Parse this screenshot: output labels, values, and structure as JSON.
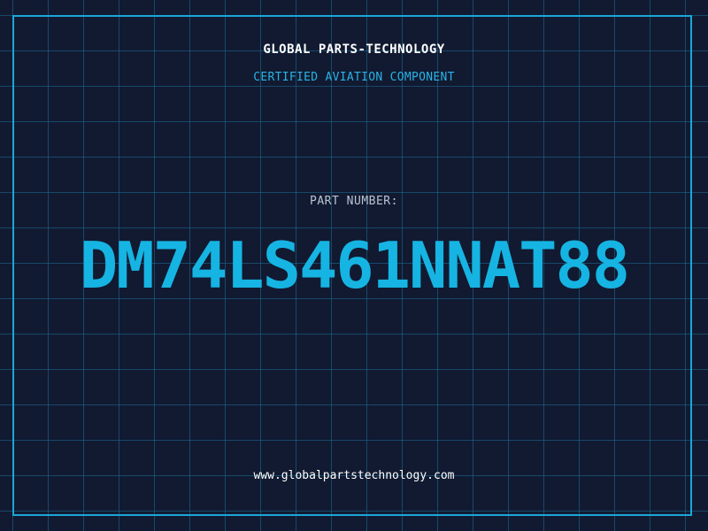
{
  "header": {
    "brand": "GLOBAL PARTS-TECHNOLOGY",
    "subtitle": "CERTIFIED AVIATION COMPONENT"
  },
  "part": {
    "label": "PART NUMBER:",
    "number": "DM74LS461NNAT88"
  },
  "footer": {
    "website": "www.globalpartstechnology.com"
  },
  "colors": {
    "background": "#111a31",
    "grid": "#1e6e96",
    "accent": "#16b4e2",
    "frame": "#1aa7d6",
    "text": "#ffffff",
    "muted": "#b9c4d2"
  }
}
